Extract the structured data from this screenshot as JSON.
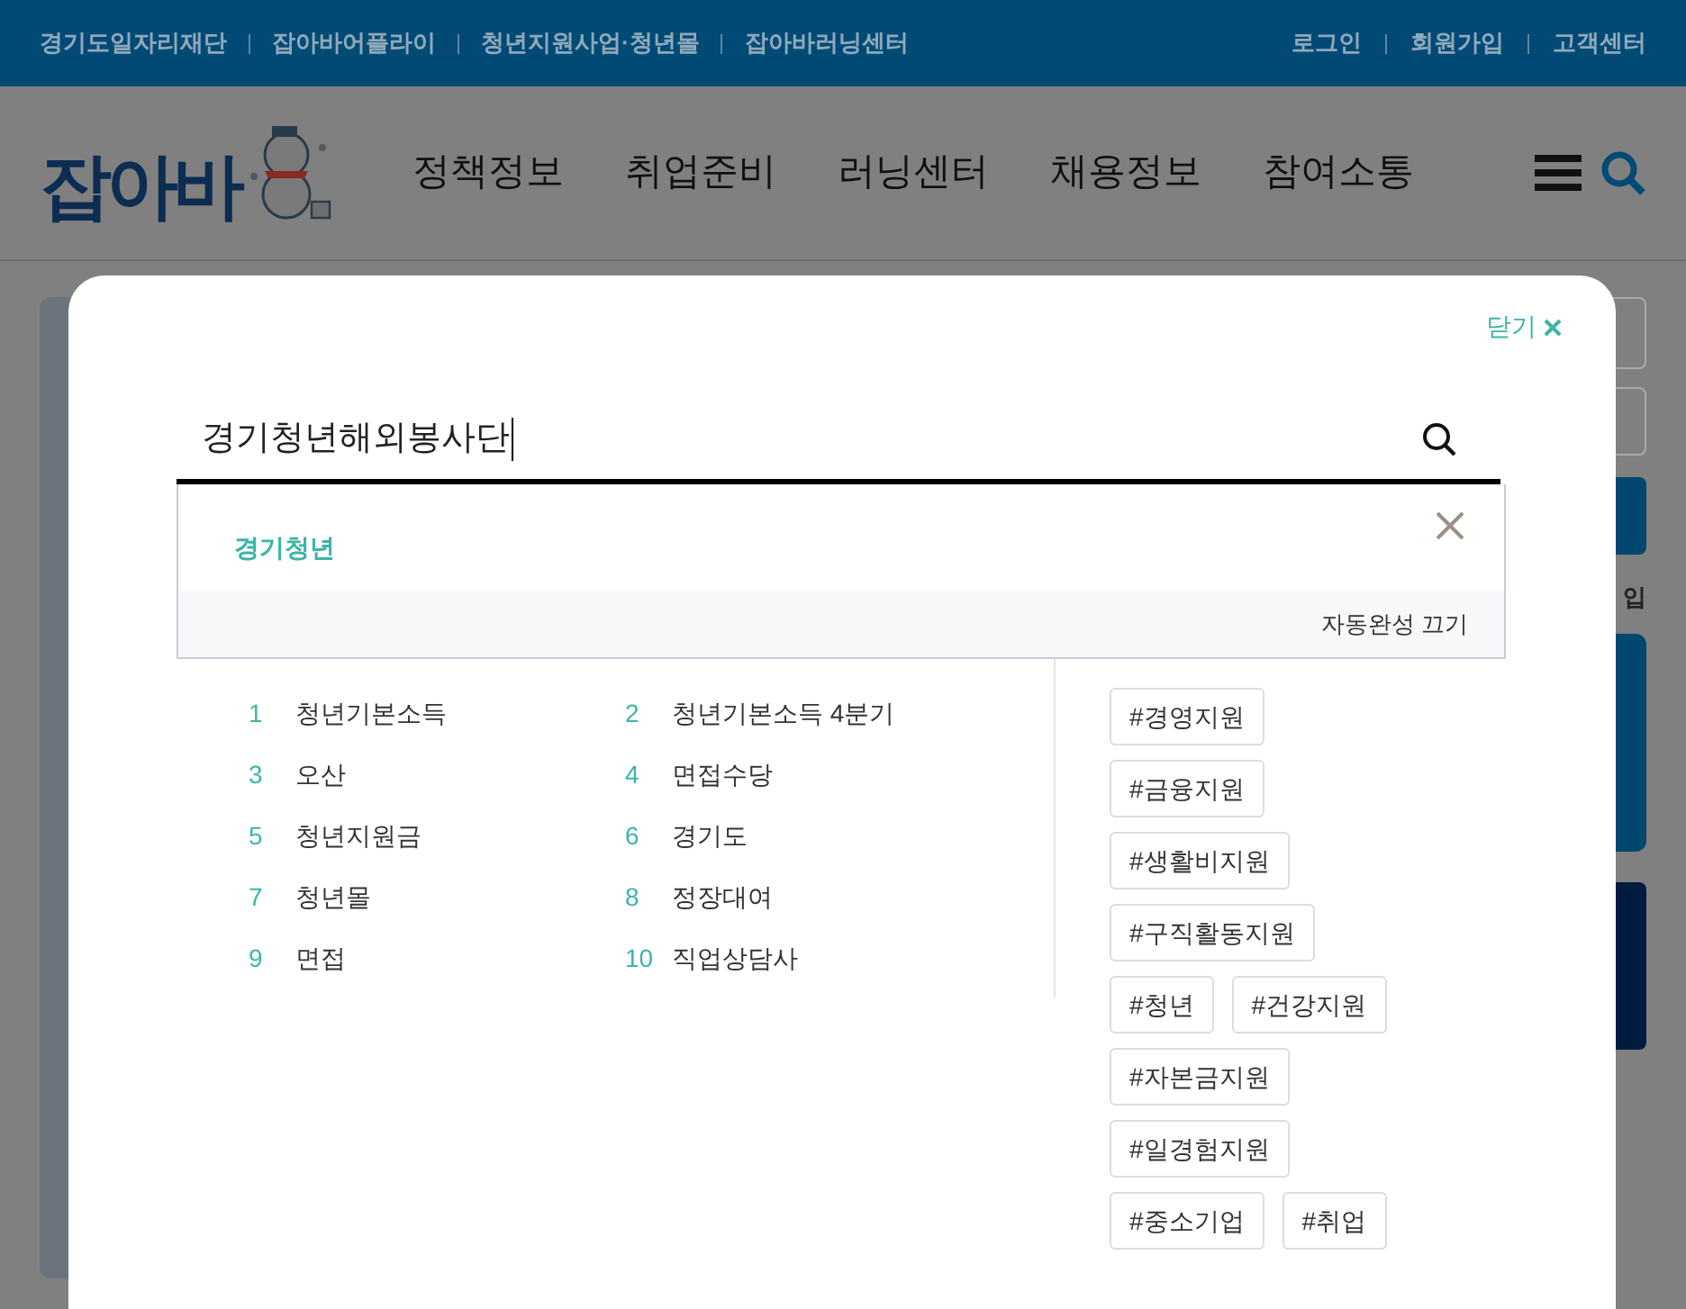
{
  "top_bar": {
    "left_links": [
      "경기도일자리재단",
      "잡아바어플라이",
      "청년지원사업·청년몰",
      "잡아바러닝센터"
    ],
    "right_links": [
      "로그인",
      "회원가입",
      "고객센터"
    ]
  },
  "header": {
    "logo": "잡아바",
    "nav": [
      "정책정보",
      "취업준비",
      "러닝센터",
      "채용정보",
      "참여소통"
    ]
  },
  "page_behind": {
    "partial_text": "입"
  },
  "search_modal": {
    "close_label": "닫기",
    "query": "경기청년해외봉사단",
    "autocomplete": {
      "suggestions": [
        "경기청년"
      ],
      "turn_off_label": "자동완성 끄기"
    },
    "popular_searches": [
      {
        "rank": "1",
        "term": "청년기본소득"
      },
      {
        "rank": "2",
        "term": "청년기본소득 4분기"
      },
      {
        "rank": "3",
        "term": "오산"
      },
      {
        "rank": "4",
        "term": "면접수당"
      },
      {
        "rank": "5",
        "term": "청년지원금"
      },
      {
        "rank": "6",
        "term": "경기도"
      },
      {
        "rank": "7",
        "term": "청년몰"
      },
      {
        "rank": "8",
        "term": "정장대여"
      },
      {
        "rank": "9",
        "term": "면접"
      },
      {
        "rank": "10",
        "term": "직업상담사"
      }
    ],
    "tags": [
      "#경영지원",
      "#금융지원",
      "#생활비지원",
      "#구직활동지원",
      "#청년",
      "#건강지원",
      "#자본금지원",
      "#일경험지원",
      "#중소기업",
      "#취업"
    ]
  }
}
